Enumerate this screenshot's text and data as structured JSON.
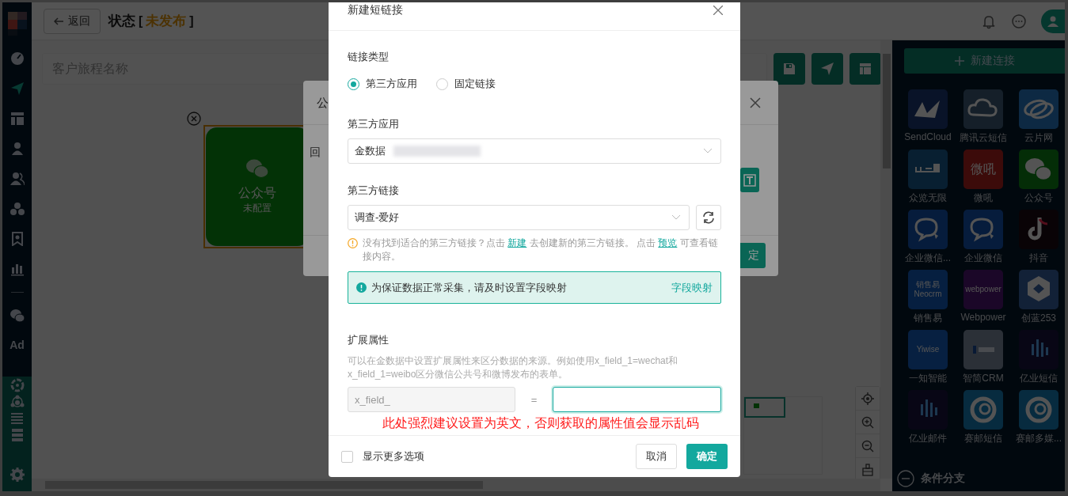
{
  "sidebar": {
    "items": [
      {
        "kind": "logo"
      },
      {
        "kind": "icon",
        "selected": false
      },
      {
        "kind": "icon",
        "selected": true
      },
      {
        "kind": "icon",
        "selected": false
      },
      {
        "kind": "icon",
        "selected": false
      },
      {
        "kind": "icon",
        "selected": false
      },
      {
        "kind": "icon",
        "selected": false
      },
      {
        "kind": "icon",
        "selected": false
      },
      {
        "kind": "icon",
        "selected": false
      },
      {
        "kind": "divider"
      },
      {
        "kind": "icon",
        "selected": false
      },
      {
        "kind": "text",
        "label": "Ad",
        "selected": false
      }
    ],
    "bottom_items": [
      {
        "kind": "icon"
      },
      {
        "kind": "icon"
      },
      {
        "kind": "icon"
      },
      {
        "kind": "icon"
      },
      {
        "kind": "gap"
      },
      {
        "kind": "icon"
      }
    ]
  },
  "header": {
    "back_label": "返回",
    "title": "状态",
    "bracket_open": "[",
    "status": "未发布",
    "bracket_close": "]"
  },
  "canvas": {
    "name_placeholder": "客户旅程名称",
    "node": {
      "title": "公众号",
      "subtitle": "未配置"
    }
  },
  "panel": {
    "new_button": "新建连接",
    "tiles": [
      {
        "label": "SendCloud"
      },
      {
        "label": "腾讯云短信"
      },
      {
        "label": "云片网"
      },
      {
        "label": "众览无限"
      },
      {
        "label": "微吼",
        "logo_lines": [
          "微吼"
        ]
      },
      {
        "label": "公众号"
      },
      {
        "label": "企业微信..."
      },
      {
        "label": "企业微信"
      },
      {
        "label": "抖音"
      },
      {
        "label": "销售易",
        "logo_lines": [
          "销售易",
          "Neocrm"
        ]
      },
      {
        "label": "Webpower",
        "logo_lines": [
          "webpower"
        ]
      },
      {
        "label": "创蓝253"
      },
      {
        "label": "一知智能",
        "logo_lines": [
          "Yiwise"
        ]
      },
      {
        "label": "智简CRM"
      },
      {
        "label": "亿业短信"
      },
      {
        "label": "亿业邮件"
      },
      {
        "label": "赛邮短信"
      },
      {
        "label": "赛邮多媒..."
      }
    ],
    "section": "条件分支"
  },
  "background_dialog": {
    "title": "公",
    "field_label": "回",
    "button": "定"
  },
  "dialog": {
    "title": "新建短链接",
    "link_type_label": "链接类型",
    "link_types": [
      {
        "label": "第三方应用",
        "selected": true
      },
      {
        "label": "固定链接",
        "selected": false
      }
    ],
    "app_label": "第三方应用",
    "app_value": "金数据",
    "link_label": "第三方链接",
    "link_value": "调查-爱好",
    "hint": {
      "before": "没有找到适合的第三方链接？点击 ",
      "link_create": "新建",
      "middle": " 去创建新的第三方链接。 点击 ",
      "link_preview": "预览",
      "after": " 可查看链接内容。"
    },
    "alert": {
      "text": "为保证数据正常采集，请及时设置字段映射",
      "action": "字段映射"
    },
    "ext_label": "扩展属性",
    "ext_description": "可以在金数据中设置扩展属性来区分数据的来源。例如使用x_field_1=wechat和x_field_1=weibo区分微信公共号和微博发布的表单。",
    "ext_key": "x_field_",
    "ext_equals": "=",
    "annotation": "此处强烈建议设置为英文，否则获取的属性值会显示乱码",
    "more_options": {
      "label": "显示更多选项",
      "checked": false
    },
    "cancel": "取消",
    "confirm": "确定"
  }
}
